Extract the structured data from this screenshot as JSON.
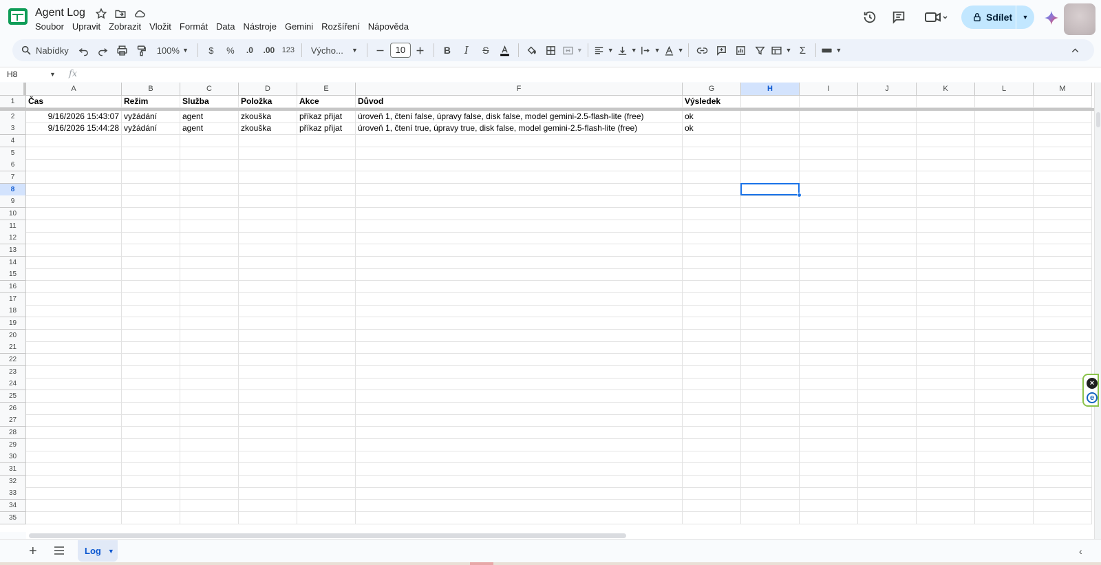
{
  "app": {
    "doc_title": "Agent Log",
    "menu": [
      "Soubor",
      "Upravit",
      "Zobrazit",
      "Vložit",
      "Formát",
      "Data",
      "Nástroje",
      "Gemini",
      "Rozšíření",
      "Nápověda"
    ],
    "share_label": "Sdílet",
    "accent_color": "#c2e7ff"
  },
  "toolbar": {
    "search_menus": "Nabídky",
    "zoom": "100%",
    "currency": "$",
    "percent": "%",
    "dec_decrease": ".0",
    "dec_increase": ".00",
    "number_format": "123",
    "font": "Výcho...",
    "font_size": "10"
  },
  "formula_bar": {
    "cell_ref": "H8",
    "fx": "fx"
  },
  "grid": {
    "columns": [
      "A",
      "B",
      "C",
      "D",
      "E",
      "F",
      "G",
      "H",
      "I",
      "J",
      "K",
      "L",
      "M"
    ],
    "active_column": "H",
    "active_row": 8,
    "row_count": 35,
    "headers": [
      "Čas",
      "Režim",
      "Služba",
      "Položka",
      "Akce",
      "Důvod",
      "Výsledek"
    ],
    "rows": [
      [
        "9/16/2026 15:43:07",
        "vyžádání",
        "agent",
        "zkouška",
        "příkaz přijat",
        "úroveň 1, čtení false, úpravy false, disk false, model gemini-2.5-flash-lite (free)",
        "ok"
      ],
      [
        "9/16/2026 15:44:28",
        "vyžádání",
        "agent",
        "zkouška",
        "příkaz přijat",
        "úroveň 1, čtení true, úpravy true, disk false, model gemini-2.5-flash-lite (free)",
        "ok"
      ]
    ]
  },
  "sheets": {
    "active_tab": "Log"
  }
}
